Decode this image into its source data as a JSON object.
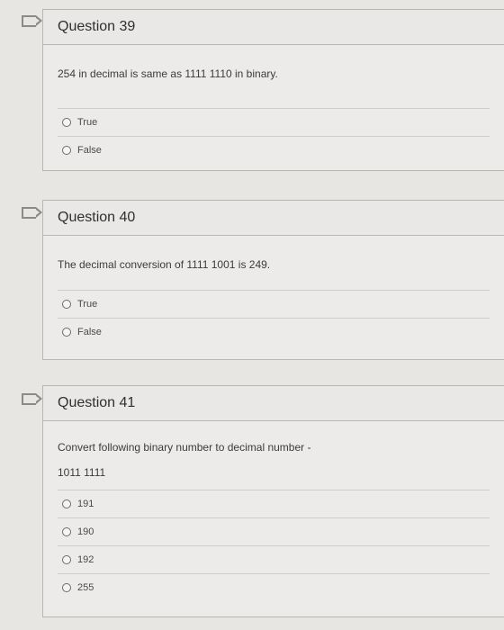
{
  "questions": [
    {
      "title": "Question 39",
      "text": "254 in decimal is same as 1111 1110 in binary.",
      "options": [
        "True",
        "False"
      ]
    },
    {
      "title": "Question 40",
      "text": "The decimal conversion of 1111 1001 is 249.",
      "options": [
        "True",
        "False"
      ]
    },
    {
      "title": "Question 41",
      "text": "Convert following binary number to decimal number -",
      "text2": "1011 1111",
      "options": [
        "191",
        "190",
        "192",
        "255"
      ]
    }
  ]
}
